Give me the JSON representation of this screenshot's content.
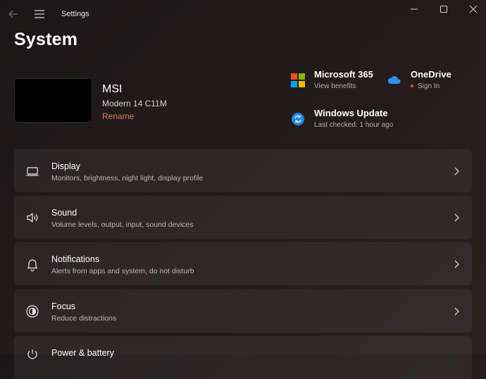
{
  "window": {
    "title": "Settings"
  },
  "page": {
    "title": "System"
  },
  "device": {
    "name": "MSI",
    "model": "Modern 14 C11M",
    "rename_label": "Rename"
  },
  "quick_links": [
    {
      "title": "Microsoft 365",
      "subtitle": "View benefits",
      "icon": "microsoft-logo-icon"
    },
    {
      "title": "OneDrive",
      "subtitle": "Sign In",
      "icon": "onedrive-cloud-icon"
    },
    {
      "title": "Windows Update",
      "subtitle": "Last checked: 1 hour ago",
      "icon": "windows-update-icon"
    }
  ],
  "settings_items": [
    {
      "title": "Display",
      "description": "Monitors, brightness, night light, display profile",
      "icon": "monitor-icon"
    },
    {
      "title": "Sound",
      "description": "Volume levels, output, input, sound devices",
      "icon": "speaker-icon"
    },
    {
      "title": "Notifications",
      "description": "Alerts from apps and system, do not disturb",
      "icon": "bell-icon"
    },
    {
      "title": "Focus",
      "description": "Reduce distractions",
      "icon": "focus-icon"
    },
    {
      "title": "Power & battery",
      "description": "",
      "icon": "power-icon"
    }
  ],
  "colors": {
    "accent_rename": "#e07a5a",
    "onedrive_dot": "#e84a3c",
    "ms_red": "#f25022",
    "ms_green": "#7fba00",
    "ms_blue": "#00a4ef",
    "ms_yellow": "#ffb900",
    "onedrive_blue": "#2f8fe8",
    "update_blue": "#1e88e5"
  }
}
